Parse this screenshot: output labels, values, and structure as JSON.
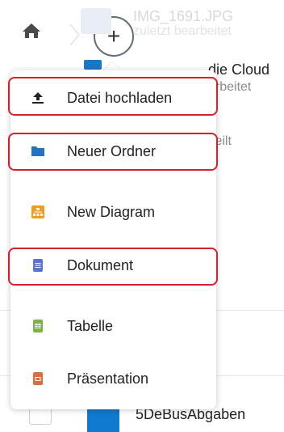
{
  "breadcrumb": {
    "home_icon": "home-icon",
    "add_label": "+"
  },
  "background_files": {
    "top_item": {
      "title": "IMG_1691.JPG",
      "subtitle": "zuletzt bearbeitet"
    },
    "cloud_item": {
      "title": "die Cloud",
      "subtitle": "arbeitet"
    },
    "shared_item": {
      "subtitle": "teilt"
    },
    "bottom_item": {
      "title": "5DeBusAbgaben"
    }
  },
  "menu": {
    "items": [
      {
        "label": "Datei hochladen",
        "icon": "upload-icon",
        "color": "#222222",
        "highlighted": true
      },
      {
        "label": "Neuer Ordner",
        "icon": "folder-icon",
        "color": "#1f75c4",
        "highlighted": true
      },
      {
        "label": "New Diagram",
        "icon": "diagram-icon",
        "color": "#f59b1f",
        "highlighted": false
      },
      {
        "label": "Dokument",
        "icon": "document-icon",
        "color": "#5b74d1",
        "highlighted": true
      },
      {
        "label": "Tabelle",
        "icon": "spreadsheet-icon",
        "color": "#7cb342",
        "highlighted": false
      },
      {
        "label": "Präsentation",
        "icon": "presentation-icon",
        "color": "#e06b3b",
        "highlighted": false
      }
    ]
  },
  "colors": {
    "highlight": "#d4212f",
    "folder_blue": "#0f7ad0"
  }
}
